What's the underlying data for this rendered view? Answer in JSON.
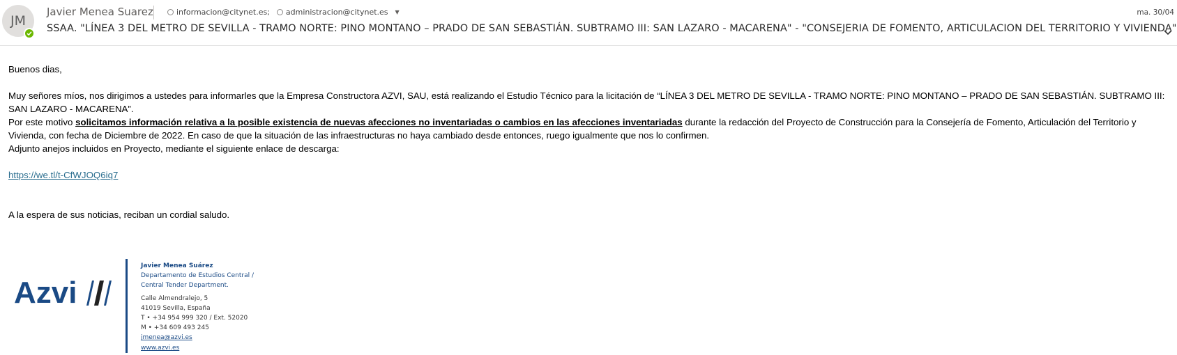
{
  "header": {
    "avatar_initials": "JM",
    "sender_name": "Javier Menea Suarez",
    "recipients": [
      "informacion@citynet.es;",
      "administracion@citynet.es"
    ],
    "date": "ma. 30/04",
    "subject": "SSAA. \"LÍNEA 3 DEL METRO DE SEVILLA - TRAMO NORTE: PINO MONTANO – PRADO DE SAN SEBASTIÁN. SUBTRAMO III: SAN LAZARO - MACARENA\" - \"CONSEJERIA DE FOMENTO, ARTICULACION DEL TERRITORIO Y VIVIENDA\"",
    "presence_color": "#6bb700",
    "icons": [
      "presence-check-icon",
      "recipient-ring-icon",
      "expand-recipients-caret-icon",
      "expand-chevron-icon"
    ]
  },
  "body": {
    "greeting": "Buenos dias,",
    "para1": "Muy señores míos, nos dirigimos a ustedes para informarles que la Empresa Constructora AZVI, SAU, está realizando el Estudio Técnico para la licitación de “LÍNEA 3 DEL METRO DE SEVILLA - TRAMO NORTE: PINO MONTANO – PRADO DE SAN SEBASTIÁN. SUBTRAMO III: SAN LAZARO - MACARENA”.",
    "para2_pre": "Por este motivo ",
    "para2_bold": "solicitamos información relativa a la posible existencia de nuevas afecciones no inventariadas o cambios en las afecciones inventariadas",
    "para2_post": " durante la redacción del Proyecto de Construcción para la Consejería de Fomento, Articulación del Territorio y Vivienda, con fecha de Diciembre de 2022. En caso de que la situación de las infraestructuras no haya cambiado desde entonces, ruego igualmente que nos lo confirmen.",
    "para3": "Adjunto anejos incluidos en Proyecto, mediante el siguiente enlace de descarga:",
    "link": "https://we.tl/t-CfWJOQ6iq7",
    "closing": "A la espera de sus noticias, reciban un cordial saludo."
  },
  "signature": {
    "logo_text": "Azvi",
    "brand_color": "#1a4a85",
    "name": "Javier Menea Suárez",
    "dept1": "Departamento de Estudios Central /",
    "dept2": "Central Tender Department.",
    "address1": "Calle Almendralejo, 5",
    "address2": "41019 Sevilla, España",
    "phone": "T •  +34 954 999 320 / Ext. 52020",
    "mobile": "M •  +34 609 493 245",
    "email": "jmenea@azvi.es",
    "website": "www.azvi.es"
  }
}
